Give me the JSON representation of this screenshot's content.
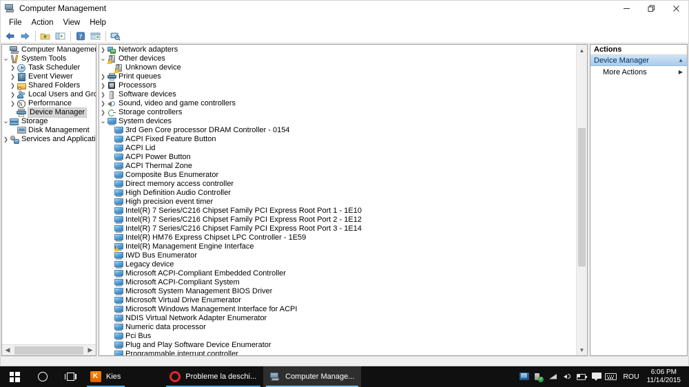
{
  "window": {
    "title": "Computer Management",
    "icon": "computer-management-icon",
    "controls": {
      "minimize": "Minimize",
      "restore": "Restore",
      "close": "Close"
    }
  },
  "menubar": {
    "items": [
      "File",
      "Action",
      "View",
      "Help"
    ]
  },
  "toolbar": {
    "buttons": [
      {
        "name": "back-icon",
        "tip": "Back"
      },
      {
        "name": "forward-icon",
        "tip": "Forward"
      },
      {
        "name": "up-folder-icon",
        "tip": "Up one level"
      },
      {
        "name": "show-hide-tree-icon",
        "tip": "Show/Hide Console Tree"
      },
      {
        "name": "help-icon",
        "tip": "Help"
      },
      {
        "name": "properties-icon",
        "tip": "Properties"
      },
      {
        "name": "scan-hardware-icon",
        "tip": "Scan for hardware changes"
      }
    ]
  },
  "console_tree": {
    "items": [
      {
        "label": "Computer Management (Local",
        "indent": 0,
        "expander": "",
        "icon": "computer-management-icon",
        "selected": false
      },
      {
        "label": "System Tools",
        "indent": 0,
        "expander": "v",
        "icon": "system-tools-icon",
        "selected": false
      },
      {
        "label": "Task Scheduler",
        "indent": 1,
        "expander": ">",
        "icon": "task-scheduler-icon",
        "selected": false
      },
      {
        "label": "Event Viewer",
        "indent": 1,
        "expander": ">",
        "icon": "event-viewer-icon",
        "selected": false
      },
      {
        "label": "Shared Folders",
        "indent": 1,
        "expander": ">",
        "icon": "shared-folders-icon",
        "selected": false
      },
      {
        "label": "Local Users and Groups",
        "indent": 1,
        "expander": ">",
        "icon": "local-users-icon",
        "selected": false
      },
      {
        "label": "Performance",
        "indent": 1,
        "expander": ">",
        "icon": "performance-icon",
        "selected": false
      },
      {
        "label": "Device Manager",
        "indent": 1,
        "expander": "",
        "icon": "device-manager-icon",
        "selected": true
      },
      {
        "label": "Storage",
        "indent": 0,
        "expander": "v",
        "icon": "storage-icon",
        "selected": false
      },
      {
        "label": "Disk Management",
        "indent": 1,
        "expander": "",
        "icon": "disk-management-icon",
        "selected": false
      },
      {
        "label": "Services and Applications",
        "indent": 0,
        "expander": ">",
        "icon": "services-icon",
        "selected": false
      }
    ]
  },
  "device_tree": {
    "items": [
      {
        "label": "Network adapters",
        "indent": 0,
        "expander": ">",
        "icon": "network-adapters-icon",
        "warning": false
      },
      {
        "label": "Other devices",
        "indent": 0,
        "expander": "v",
        "icon": "other-devices-icon",
        "warning": true
      },
      {
        "label": "Unknown device",
        "indent": 1,
        "expander": "",
        "icon": "unknown-device-icon",
        "warning": true
      },
      {
        "label": "Print queues",
        "indent": 0,
        "expander": ">",
        "icon": "print-queues-icon",
        "warning": false
      },
      {
        "label": "Processors",
        "indent": 0,
        "expander": ">",
        "icon": "processors-icon",
        "warning": false
      },
      {
        "label": "Software devices",
        "indent": 0,
        "expander": ">",
        "icon": "software-devices-icon",
        "warning": false
      },
      {
        "label": "Sound, video and game controllers",
        "indent": 0,
        "expander": ">",
        "icon": "sound-video-icon",
        "warning": false
      },
      {
        "label": "Storage controllers",
        "indent": 0,
        "expander": ">",
        "icon": "storage-controllers-icon",
        "warning": false
      },
      {
        "label": "System devices",
        "indent": 0,
        "expander": "v",
        "icon": "system-devices-icon",
        "warning": false
      },
      {
        "label": "3rd Gen Core processor DRAM Controller - 0154",
        "indent": 1,
        "expander": "",
        "icon": "system-device-icon",
        "warning": false
      },
      {
        "label": "ACPI Fixed Feature Button",
        "indent": 1,
        "expander": "",
        "icon": "system-device-icon",
        "warning": false
      },
      {
        "label": "ACPI Lid",
        "indent": 1,
        "expander": "",
        "icon": "system-device-icon",
        "warning": false
      },
      {
        "label": "ACPI Power Button",
        "indent": 1,
        "expander": "",
        "icon": "system-device-icon",
        "warning": false
      },
      {
        "label": "ACPI Thermal Zone",
        "indent": 1,
        "expander": "",
        "icon": "system-device-icon",
        "warning": false
      },
      {
        "label": "Composite Bus Enumerator",
        "indent": 1,
        "expander": "",
        "icon": "system-device-icon",
        "warning": false
      },
      {
        "label": "Direct memory access controller",
        "indent": 1,
        "expander": "",
        "icon": "system-device-icon",
        "warning": false
      },
      {
        "label": "High Definition Audio Controller",
        "indent": 1,
        "expander": "",
        "icon": "system-device-icon",
        "warning": false
      },
      {
        "label": "High precision event timer",
        "indent": 1,
        "expander": "",
        "icon": "system-device-icon",
        "warning": false
      },
      {
        "label": "Intel(R) 7 Series/C216 Chipset Family PCI Express Root Port 1 - 1E10",
        "indent": 1,
        "expander": "",
        "icon": "system-device-icon",
        "warning": false
      },
      {
        "label": "Intel(R) 7 Series/C216 Chipset Family PCI Express Root Port 2 - 1E12",
        "indent": 1,
        "expander": "",
        "icon": "system-device-icon",
        "warning": false
      },
      {
        "label": "Intel(R) 7 Series/C216 Chipset Family PCI Express Root Port 3 - 1E14",
        "indent": 1,
        "expander": "",
        "icon": "system-device-icon",
        "warning": false
      },
      {
        "label": "Intel(R) HM76 Express Chipset LPC Controller - 1E59",
        "indent": 1,
        "expander": "",
        "icon": "system-device-icon",
        "warning": false
      },
      {
        "label": "Intel(R) Management Engine Interface",
        "indent": 1,
        "expander": "",
        "icon": "system-device-icon",
        "warning": true
      },
      {
        "label": "IWD Bus Enumerator",
        "indent": 1,
        "expander": "",
        "icon": "system-device-icon",
        "warning": false
      },
      {
        "label": "Legacy device",
        "indent": 1,
        "expander": "",
        "icon": "system-device-icon",
        "warning": false
      },
      {
        "label": "Microsoft ACPI-Compliant Embedded Controller",
        "indent": 1,
        "expander": "",
        "icon": "system-device-icon",
        "warning": false
      },
      {
        "label": "Microsoft ACPI-Compliant System",
        "indent": 1,
        "expander": "",
        "icon": "system-device-icon",
        "warning": false
      },
      {
        "label": "Microsoft System Management BIOS Driver",
        "indent": 1,
        "expander": "",
        "icon": "system-device-icon",
        "warning": false
      },
      {
        "label": "Microsoft Virtual Drive Enumerator",
        "indent": 1,
        "expander": "",
        "icon": "system-device-icon",
        "warning": false
      },
      {
        "label": "Microsoft Windows Management Interface for ACPI",
        "indent": 1,
        "expander": "",
        "icon": "system-device-icon",
        "warning": false
      },
      {
        "label": "NDIS Virtual Network Adapter Enumerator",
        "indent": 1,
        "expander": "",
        "icon": "system-device-icon",
        "warning": false
      },
      {
        "label": "Numeric data processor",
        "indent": 1,
        "expander": "",
        "icon": "system-device-icon",
        "warning": false
      },
      {
        "label": "Pci Bus",
        "indent": 1,
        "expander": "",
        "icon": "system-device-icon",
        "warning": false
      },
      {
        "label": "Plug and Play Software Device Enumerator",
        "indent": 1,
        "expander": "",
        "icon": "system-device-icon",
        "warning": false
      },
      {
        "label": "Programmable interrupt controller",
        "indent": 1,
        "expander": "",
        "icon": "system-device-icon",
        "warning": false
      }
    ]
  },
  "actions": {
    "header": "Actions",
    "group_label": "Device Manager",
    "group_chevron": "▲",
    "items": [
      {
        "label": "More Actions",
        "arrow": "▶"
      }
    ]
  },
  "taskbar": {
    "start": "start-button",
    "cortana": "cortana-search-button",
    "taskview": "task-view-button",
    "apps": [
      {
        "label": "Kies",
        "icon": "kies-icon",
        "active": false
      },
      {
        "label": "Probleme la deschi...",
        "icon": "opera-icon",
        "active": false
      },
      {
        "label": "Computer Manage...",
        "icon": "computer-management-icon",
        "active": true
      }
    ],
    "tray": {
      "icons": [
        {
          "name": "network-shield-icon"
        },
        {
          "name": "safely-remove-hardware-icon"
        },
        {
          "name": "wifi-icon"
        },
        {
          "name": "volume-icon"
        },
        {
          "name": "battery-icon"
        },
        {
          "name": "action-center-icon"
        },
        {
          "name": "touch-keyboard-icon"
        }
      ],
      "language": "ROU",
      "time": "6:06 PM",
      "date": "11/14/2015"
    }
  }
}
